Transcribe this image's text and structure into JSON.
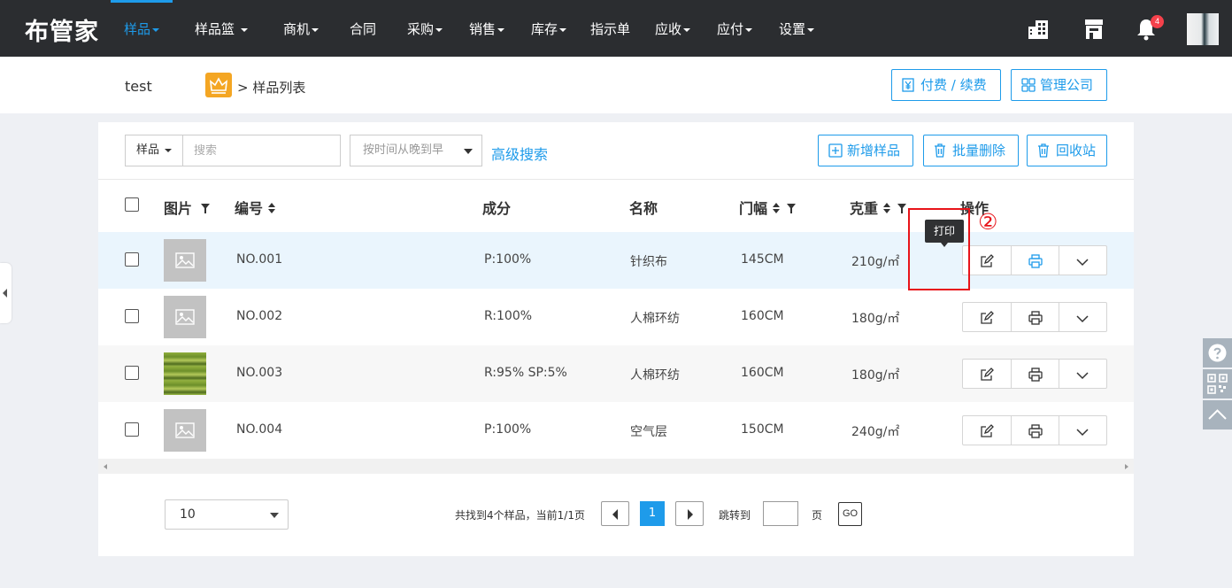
{
  "nav": {
    "logo": "布管家",
    "items": [
      {
        "label": "样品",
        "dropdown": true,
        "active": true
      },
      {
        "label": "样品篮",
        "dropdown": true
      },
      {
        "label": "商机",
        "dropdown": true
      },
      {
        "label": "合同",
        "dropdown": false
      },
      {
        "label": "采购",
        "dropdown": true
      },
      {
        "label": "销售",
        "dropdown": true
      },
      {
        "label": "库存",
        "dropdown": true
      },
      {
        "label": "指示单",
        "dropdown": false
      },
      {
        "label": "应收",
        "dropdown": true
      },
      {
        "label": "应付",
        "dropdown": true
      },
      {
        "label": "设置",
        "dropdown": true
      }
    ],
    "notification_count": "4",
    "accent_color": "#1e9bea"
  },
  "header": {
    "tenant": "test",
    "breadcrumb": "> 样品列表",
    "pay_button": "付费 / 续费",
    "manage_button": "管理公司"
  },
  "toolbar": {
    "type_select": "样品",
    "search_placeholder": "搜索",
    "sort_select": "按时间从晚到早",
    "advanced_search": "高级搜索",
    "add_button": "新增样品",
    "batch_delete_button": "批量删除",
    "recycle_button": "回收站"
  },
  "table": {
    "columns": [
      "图片",
      "编号",
      "成分",
      "名称",
      "门幅",
      "克重",
      "操作"
    ],
    "rows": [
      {
        "code": "NO.001",
        "composition": "P:100%",
        "name": "针织布",
        "width": "145CM",
        "weight": "210g/㎡",
        "image": "placeholder"
      },
      {
        "code": "NO.002",
        "composition": "R:100%",
        "name": "人棉环纺",
        "width": "160CM",
        "weight": "180g/㎡",
        "image": "placeholder"
      },
      {
        "code": "NO.003",
        "composition": "R:95% SP:5%",
        "name": "人棉环纺",
        "width": "160CM",
        "weight": "180g/㎡",
        "image": "fabric-photo"
      },
      {
        "code": "NO.004",
        "composition": "P:100%",
        "name": "空气层",
        "width": "150CM",
        "weight": "240g/㎡",
        "image": "placeholder"
      }
    ]
  },
  "tooltip": "打印",
  "annotation_marker": "②",
  "pagination": {
    "page_size": "10",
    "summary": "共找到4个样品，当前1/1页",
    "current_page": "1",
    "jump_label": "跳转到",
    "page_unit": "页",
    "go_label": "GO"
  }
}
